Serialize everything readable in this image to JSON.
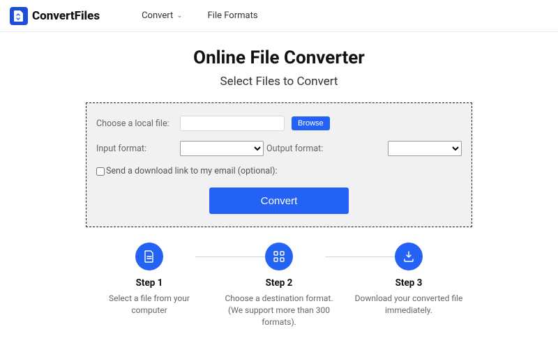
{
  "header": {
    "brand": "ConvertFiles",
    "nav": {
      "convert": "Convert",
      "formats": "File Formats"
    }
  },
  "hero": {
    "title": "Online File Converter",
    "subtitle": "Select Files to Convert"
  },
  "form": {
    "choose_label": "Choose a local file:",
    "browse": "Browse",
    "input_fmt_label": "Input format:",
    "output_fmt_label": "Output format:",
    "email_checkbox": "Send a download link to my email (optional):",
    "convert": "Convert"
  },
  "steps": [
    {
      "title": "Step 1",
      "desc": "Select a file from your computer"
    },
    {
      "title": "Step 2",
      "desc": "Choose a destination format. (We support more than 300 formats)."
    },
    {
      "title": "Step 3",
      "desc": "Download your converted file immediately."
    }
  ]
}
